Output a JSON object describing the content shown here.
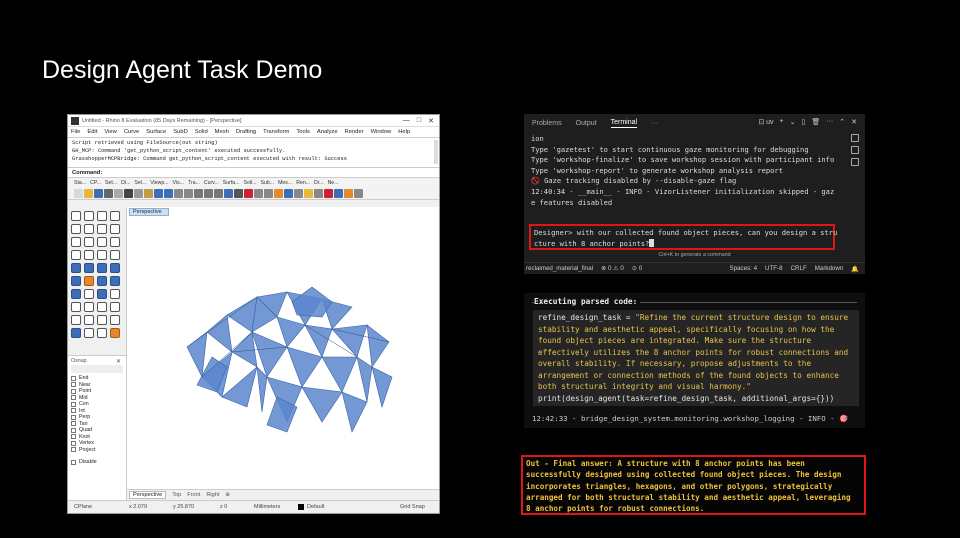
{
  "slide": {
    "title": "Design Agent Task Demo"
  },
  "rhino": {
    "window_title": "Untitled - Rhino 8 Evaluation (85 Days Remaining) - [Perspective]",
    "window_buttons": [
      "—",
      "□",
      "✕"
    ],
    "menu": [
      "File",
      "Edit",
      "View",
      "Curve",
      "Surface",
      "SubD",
      "Solid",
      "Mesh",
      "Drafting",
      "Transform",
      "Tools",
      "Analyze",
      "Render",
      "Window",
      "Help"
    ],
    "console_lines": [
      "Script retrieved using FileSource(out string)",
      "GH_MCP: Command 'get_python_script_content' executed successfully.",
      "GrasshopperMCPBridge: Command get_python_script_content executed with result: Success"
    ],
    "command_label": "Command:",
    "toolbar_tabs": [
      "Sta...",
      "CP...",
      "Set...",
      "Di...",
      "Sel...",
      "Viewp...",
      "Vis...",
      "Tra...",
      "Curv...",
      "Surfa...",
      "Soli...",
      "Sub...",
      "Mes...",
      "Ren...",
      "Dr...",
      "Ne..."
    ],
    "viewport_label": "Perspective",
    "osnap_title": "Osnap",
    "osnap_items": [
      "End",
      "Near",
      "Point",
      "Mid",
      "Cen",
      "Int",
      "Perp",
      "Tan",
      "Quad",
      "Knot",
      "Vertex",
      "Project"
    ],
    "osnap_disable": "Disable",
    "view_tabs": [
      "Perspective",
      "Top",
      "Front",
      "Right",
      "⊕"
    ],
    "status": {
      "cplane": "CPlane",
      "x": "x 2.079",
      "y": "y 25.870",
      "z": "z 0",
      "units": "Millimeters",
      "layer": "Default",
      "grid_snap": "Grid Snap"
    },
    "mesh_fill": "#5b86cc",
    "mesh_stroke": "#3a64a8"
  },
  "vscode": {
    "tabs": [
      "Problems",
      "Output",
      "Terminal",
      "···"
    ],
    "active_tab": "Terminal",
    "terminal_icons": [
      "⊡ uv",
      "+",
      "⌄",
      "▯",
      "🗑",
      "···",
      "⌃",
      "✕"
    ],
    "lines": [
      "ion",
      "Type 'gazetest' to start continuous gaze monitoring for debugging",
      "Type 'workshop-finalize' to save workshop session with participant info",
      "Type 'workshop-report' to generate workshop analysis report",
      "",
      "🚫 Gaze tracking disabled by --disable-gaze flag",
      "12:40:34 - __main__ - INFO - VizorListener initialization skipped - gaz",
      "e features disabled"
    ],
    "input_lines": [
      "Designer> with our collected found object pieces, can you design a stru",
      "cture with 8 anchor points?"
    ],
    "hint": "Ctrl+K to generate a command",
    "status": {
      "branch": "reclaimed_material_final",
      "errors": "⊗ 0 ⚠ 0",
      "ports": "⊙ 0",
      "spaces": "Spaces: 4",
      "encoding": "UTF-8",
      "eol": "CRLF",
      "language": "Markdown",
      "bell": "🔔"
    }
  },
  "code_panel": {
    "header": "Executing parsed code:",
    "lines": [
      {
        "text": "refine_design_task = ",
        "str": "\"Refine the current structure design to ensure"
      },
      {
        "text": "",
        "str": "stability and aesthetic appeal, specifically focusing on how the"
      },
      {
        "text": "",
        "str": "found object pieces are integrated. Make sure the structure"
      },
      {
        "text": "",
        "str": "effectively utilizes the 8 anchor points for robust connections and"
      },
      {
        "text": "",
        "str": "overall stability. If necessary, propose adjustments to the"
      },
      {
        "text": "",
        "str": "arrangement or connection methods of the found objects to enhance"
      },
      {
        "text": "",
        "str": "both structural integrity and visual harmony.\""
      },
      {
        "text": "print(design_agent(task=refine_design_task, additional_args={}))",
        "str": ""
      }
    ],
    "log": "12:42:33 - bridge_design_system.monitoring.workshop_logging - INFO - 🎯"
  },
  "final_answer": {
    "lines": [
      "Out - Final answer: A structure with 8 anchor points has been",
      "successfully designed using collected found object pieces. The design",
      "incorporates triangles, hexagons, and other polygons, strategically",
      "arranged for both structural stability and aesthetic appeal, leveraging",
      "8 anchor points for robust connections."
    ]
  }
}
